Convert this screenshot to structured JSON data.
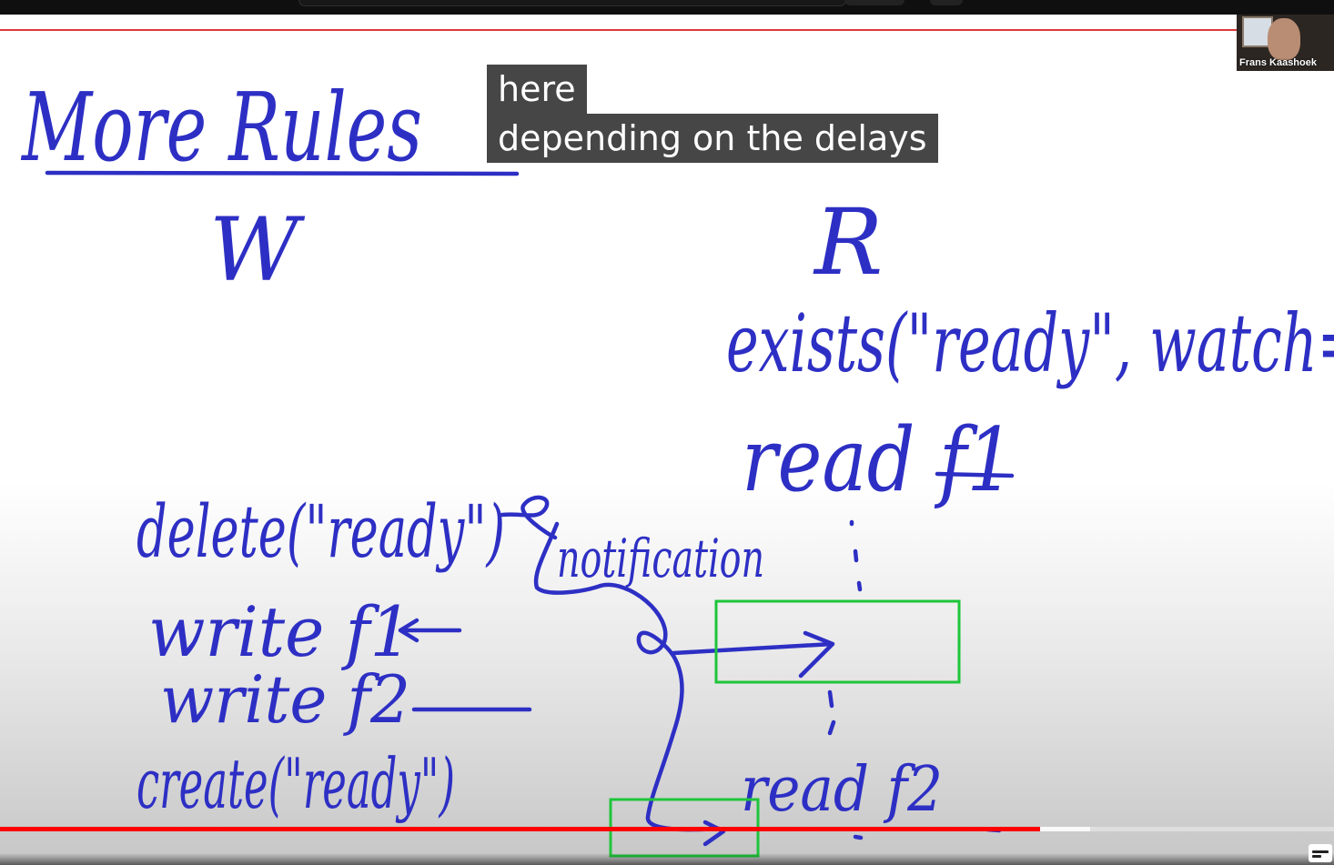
{
  "player": {
    "captions": [
      "here",
      "depending on the delays"
    ],
    "speaker_name": "Frans Kaashoek",
    "progress_played_fraction": 0.78,
    "progress_buffered_fraction": 0.817,
    "accent_color": "#ff0000"
  },
  "whiteboard": {
    "title": "More Rules",
    "writer_label": "W",
    "reader_label": "R",
    "reader_ops": [
      "exists(\"ready\", watch=",
      "read f1",
      "read f2"
    ],
    "writer_ops": [
      "delete(\"ready\")",
      "write f1",
      "write f2",
      "create(\"ready\")"
    ],
    "annotation": "notification",
    "ink_color": "#2d2fc4",
    "box_color": "#1ec53a"
  },
  "icons": {
    "subtitles": "subtitles-icon"
  }
}
